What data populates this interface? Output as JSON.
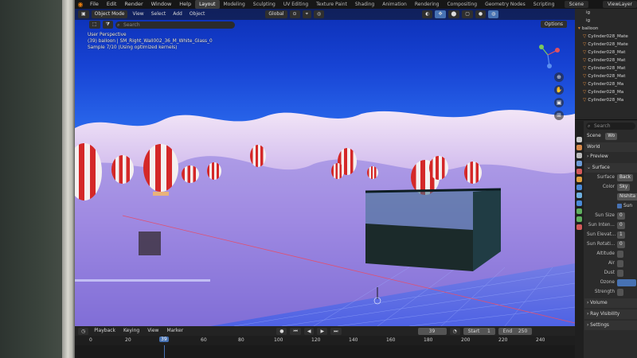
{
  "topbar": {
    "menus": [
      "File",
      "Edit",
      "Render",
      "Window",
      "Help"
    ],
    "workspace_tabs": [
      "Layout",
      "Modeling",
      "Sculpting",
      "UV Editing",
      "Texture Paint",
      "Shading",
      "Animation",
      "Rendering",
      "Compositing",
      "Geometry Nodes",
      "Scripting"
    ],
    "active_tab": "Layout",
    "scene": "Scene",
    "view_layer": "ViewLayer"
  },
  "viewport": {
    "mode": "Object Mode",
    "menus": [
      "View",
      "Select",
      "Add",
      "Object"
    ],
    "transform": "Global",
    "search_placeholder": "Search",
    "options_label": "Options",
    "overlay": {
      "line1": "User Perspective",
      "line2": "(39) balloon | SM_Right_Wall002_36_M_White_Glass_0",
      "line3": "Sample 7/10 (Using optimized kernels)"
    }
  },
  "timeline": {
    "playback_label": "Playback",
    "keying_label": "Keying",
    "view_label": "View",
    "marker_label": "Marker",
    "current_frame": "39",
    "start_label": "Start",
    "start_value": "1",
    "end_label": "End",
    "end_value": "250",
    "ruler_ticks": [
      "0",
      "20",
      "60",
      "80",
      "100",
      "120",
      "140",
      "160",
      "180",
      "200",
      "220",
      "240"
    ]
  },
  "outliner": {
    "rows": [
      "balloon",
      "Cylinder028_Mate",
      "Cylinder028_Mate",
      "Cylinder028_Mat",
      "Cylinder028_Mat",
      "Cylinder028_Mat",
      "Cylinder028_Mat",
      "Cylinder028_Ma",
      "Cylinder028_Ma",
      "Cylinder028_Ma"
    ],
    "top_rows": [
      "ig",
      "ig"
    ]
  },
  "properties": {
    "search_placeholder": "Search",
    "scene_label": "Scene",
    "scene_value": "Wo",
    "world_label": "World",
    "preview_label": "Preview",
    "surface_section": "Surface",
    "surface_label": "Surface",
    "surface_value": "Back",
    "color_label": "Color",
    "color_value": "Sky",
    "sky_type": "Nishita",
    "sun_disc": "Sun",
    "sun_size": "Sun Size",
    "sun_size_val": "0",
    "sun_intensity": "Sun Inten...",
    "sun_intensity_val": "0",
    "sun_elevation": "Sun Elevat...",
    "sun_elevation_val": "1",
    "sun_rotation": "Sun Rotati...",
    "sun_rotation_val": "0",
    "altitude": "Altitude",
    "air": "Air",
    "dust": "Dust",
    "ozone": "Ozone",
    "strength": "Strength",
    "volume_section": "Volume",
    "ray_visibility": "Ray Visibility",
    "settings": "Settings"
  }
}
